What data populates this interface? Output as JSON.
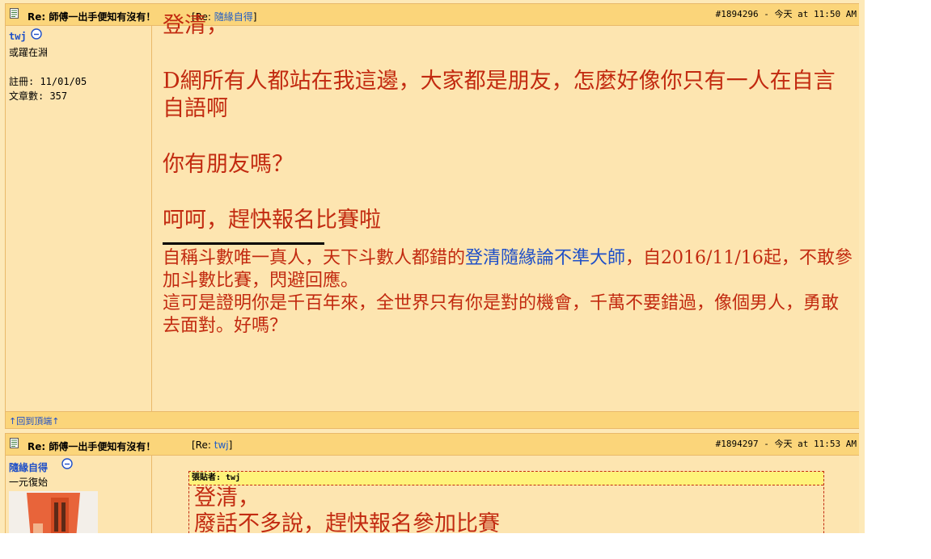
{
  "post1": {
    "title": "Re: 師傅一出手便知有沒有！",
    "reply_prefix": "[Re: ",
    "reply_link": "隨緣自得",
    "reply_suffix": "]",
    "meta": "#1894296 - 今天 at 11:50 AM",
    "user": {
      "name": "twj",
      "title": "或躍在淵",
      "registered": "註冊: 11/01/05",
      "posts": "文章數: 357"
    },
    "body": {
      "line1": "登清，",
      "line2": "D網所有人都站在我這邊，大家都是朋友，怎麼好像你只有一人在自言自語啊",
      "line3": "你有朋友嗎？",
      "line4": "呵呵，趕快報名比賽啦"
    },
    "signature": {
      "part1": "自稱斗數唯一真人，天下斗數人都錯的",
      "link": "登清隨緣論不準大師",
      "part2": "，自2016/11/16起，不敢參加斗數比賽，閃避回應。",
      "line2": "這可是證明你是千百年來，全世界只有你是對的機會，千萬不要錯過，像個男人，勇敢去面對。好嗎？"
    },
    "back_to_top": "↑回到頂端↑"
  },
  "post2": {
    "title": "Re: 師傅一出手便知有沒有！",
    "reply_prefix": "[Re: ",
    "reply_link": "twj",
    "reply_suffix": "]",
    "meta": "#1894297 - 今天 at 11:53 AM",
    "user": {
      "name": "隨緣自得",
      "title": "一元復始"
    },
    "quote": {
      "header": "張貼者: twj",
      "line1": "登清，",
      "line2": "廢話不多說，趕快報名參加比賽"
    }
  },
  "colors": {
    "header_bg": "#fbd57a",
    "body_bg": "#fde5b0",
    "post_text": "#c22a10",
    "link": "#1e4fc8"
  },
  "icons": [
    "post-doc-icon",
    "online-status-icon",
    "avatar-image"
  ]
}
